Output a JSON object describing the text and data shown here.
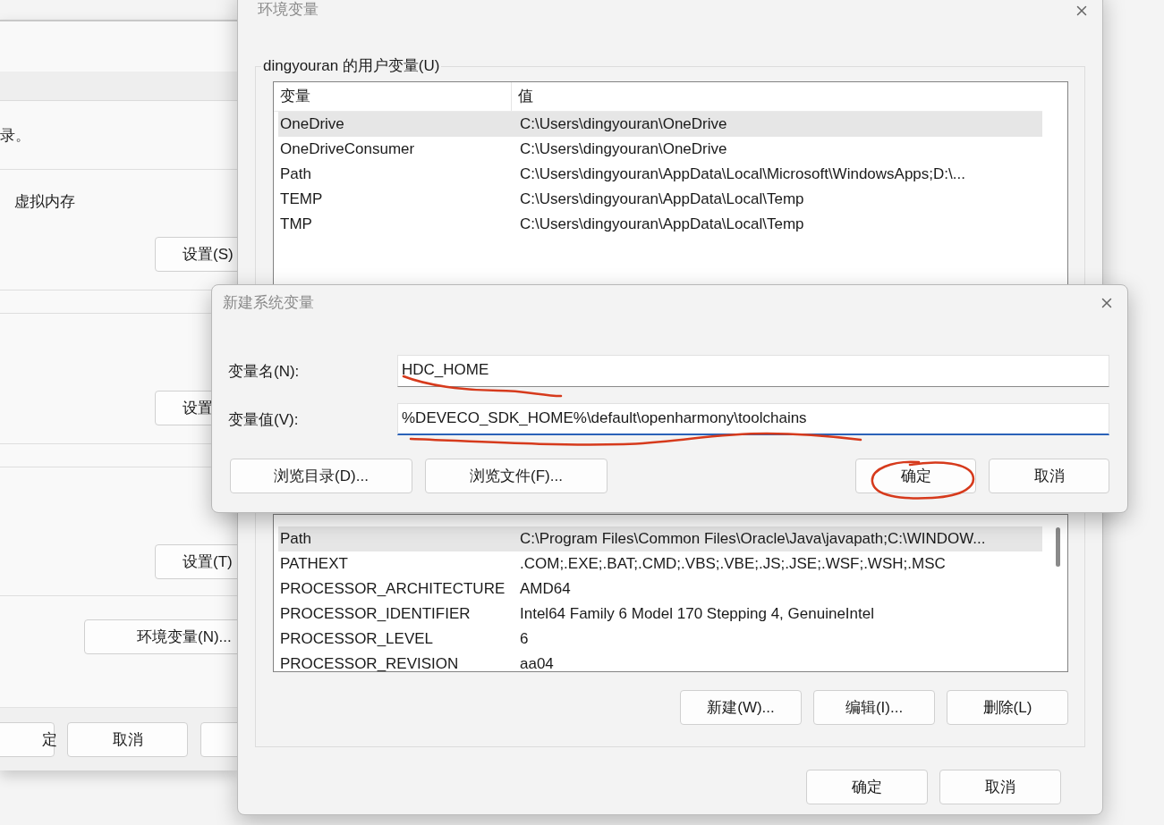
{
  "system_properties": {
    "texts": [
      "录。",
      "虚拟内存"
    ],
    "buttons": [
      {
        "label": "设置(S)"
      },
      {
        "label": "设置"
      },
      {
        "label": "设置(T)"
      },
      {
        "label": "环境变量(N)..."
      }
    ],
    "footer_buttons": [
      {
        "label": "定"
      },
      {
        "label": "取消"
      }
    ]
  },
  "env_window": {
    "title": "环境变量",
    "user_vars": {
      "label": "dingyouran 的用户变量(U)",
      "columns": [
        "变量",
        "值"
      ],
      "rows": [
        {
          "name": "OneDrive",
          "value": "C:\\Users\\dingyouran\\OneDrive",
          "selected": true
        },
        {
          "name": "OneDriveConsumer",
          "value": "C:\\Users\\dingyouran\\OneDrive",
          "selected": false
        },
        {
          "name": "Path",
          "value": "C:\\Users\\dingyouran\\AppData\\Local\\Microsoft\\WindowsApps;D:\\...",
          "selected": false
        },
        {
          "name": "TEMP",
          "value": "C:\\Users\\dingyouran\\AppData\\Local\\Temp",
          "selected": false
        },
        {
          "name": "TMP",
          "value": "C:\\Users\\dingyouran\\AppData\\Local\\Temp",
          "selected": false
        }
      ]
    },
    "system_vars": {
      "rows": [
        {
          "name": "Path",
          "value": "C:\\Program Files\\Common Files\\Oracle\\Java\\javapath;C:\\WINDOW...",
          "selected": true
        },
        {
          "name": "PATHEXT",
          "value": ".COM;.EXE;.BAT;.CMD;.VBS;.VBE;.JS;.JSE;.WSF;.WSH;.MSC",
          "selected": false
        },
        {
          "name": "PROCESSOR_ARCHITECTURE",
          "value": "AMD64",
          "selected": false
        },
        {
          "name": "PROCESSOR_IDENTIFIER",
          "value": "Intel64 Family 6 Model 170 Stepping 4, GenuineIntel",
          "selected": false
        },
        {
          "name": "PROCESSOR_LEVEL",
          "value": "6",
          "selected": false
        },
        {
          "name": "PROCESSOR_REVISION",
          "value": "aa04",
          "selected": false
        }
      ],
      "buttons": [
        "新建(W)...",
        "编辑(I)...",
        "删除(L)"
      ]
    },
    "buttons": [
      "确定",
      "取消"
    ]
  },
  "new_var_dialog": {
    "title": "新建系统变量",
    "fields": [
      {
        "label": "变量名(N):",
        "value": "HDC_HOME",
        "focused": false
      },
      {
        "label": "变量值(V):",
        "value": "%DEVECO_SDK_HOME%\\default\\openharmony\\toolchains",
        "focused": true
      }
    ],
    "left_buttons": [
      "浏览目录(D)...",
      "浏览文件(F)..."
    ],
    "right_buttons": [
      "确定",
      "取消"
    ]
  }
}
